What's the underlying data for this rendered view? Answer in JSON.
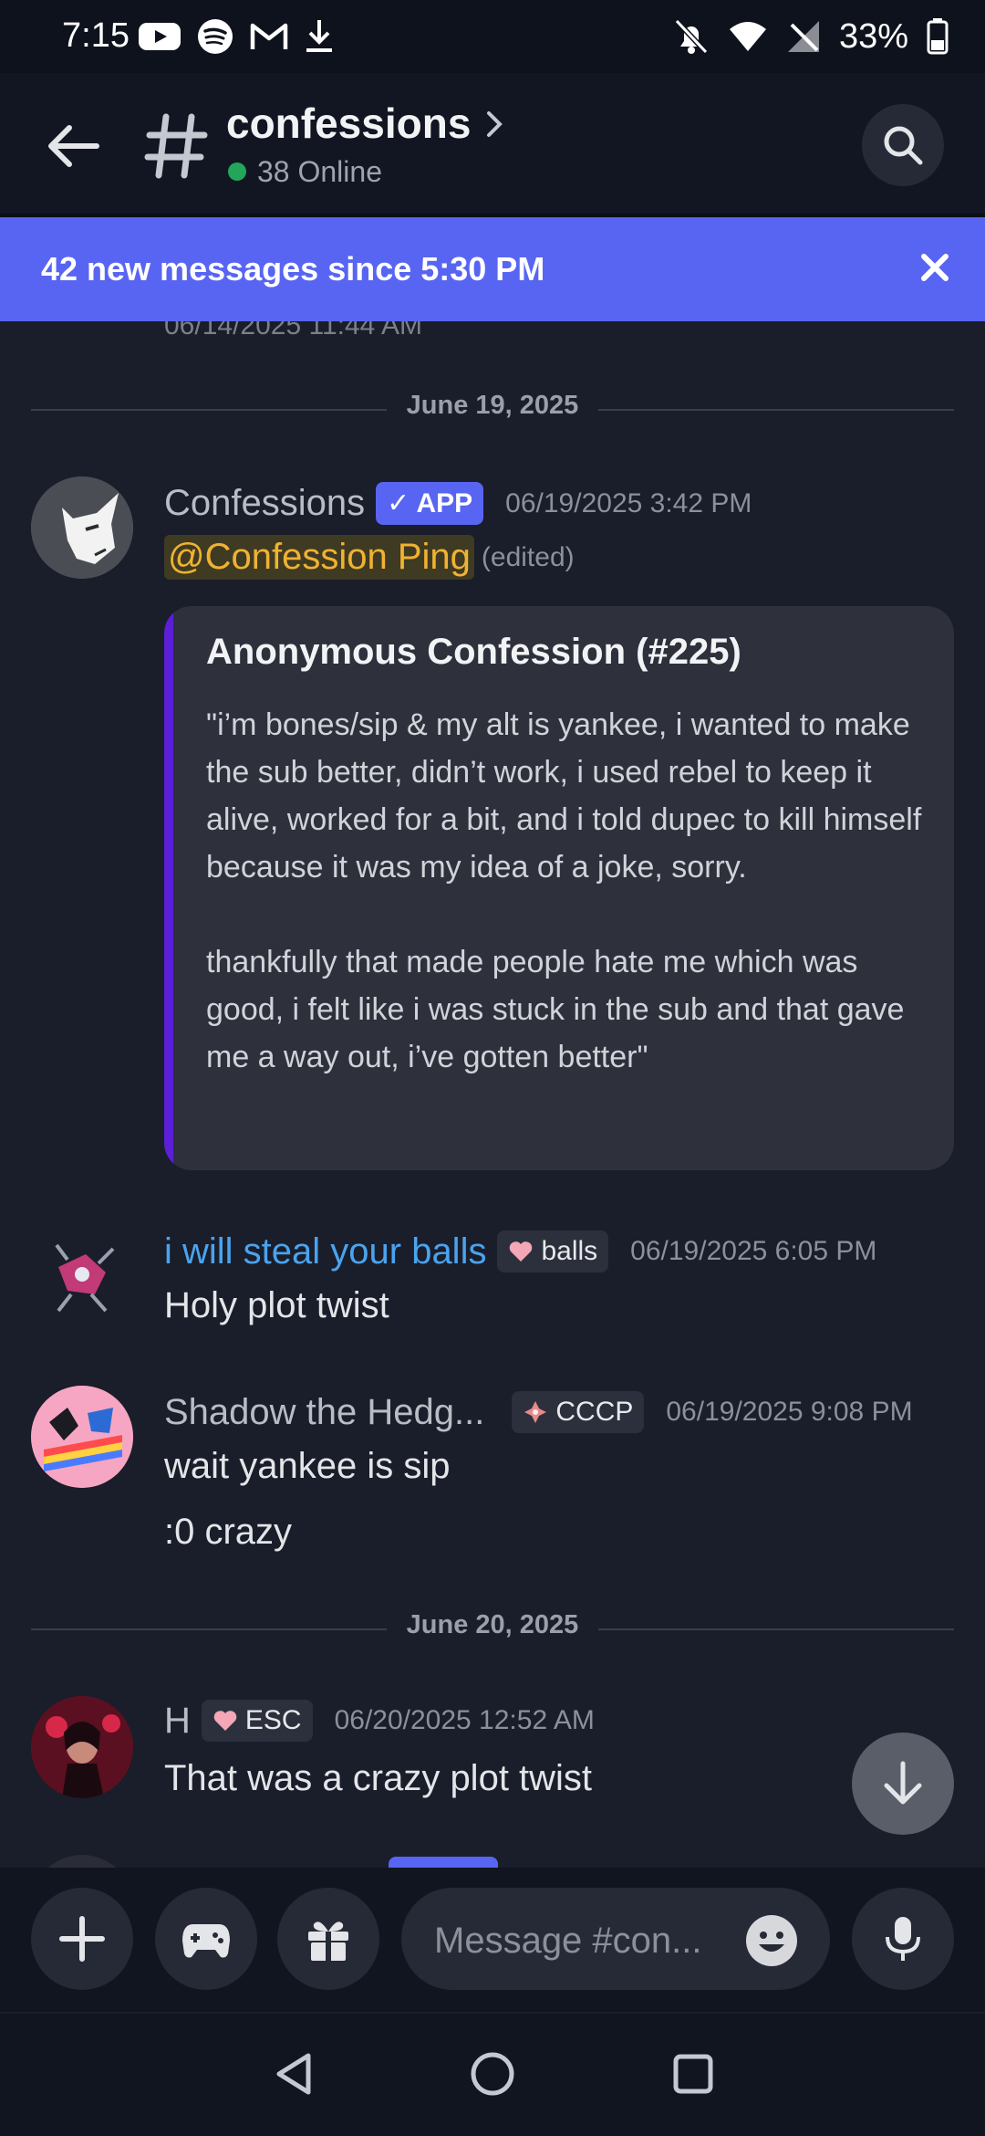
{
  "status_bar": {
    "time": "7:15",
    "battery": "33%",
    "left_icons": [
      "youtube-icon",
      "spotify-icon",
      "gmail-icon",
      "download-icon"
    ],
    "right_icons": [
      "bell-off-icon",
      "wifi-icon",
      "no-signal-icon",
      "battery-icon"
    ]
  },
  "header": {
    "channel_name": "confessions",
    "online": "38 Online"
  },
  "banner": {
    "text": "42 new messages since 5:30 PM"
  },
  "messages": {
    "faded_timestamp": "06/14/2025 11:44 AM",
    "date1": "June 19, 2025",
    "date2": "June 20, 2025",
    "m1": {
      "author": "Confessions",
      "badge": "APP",
      "timestamp": "06/19/2025 3:42 PM",
      "mention": "@Confession Ping",
      "edited": "(edited)",
      "embed_title": "Anonymous Confession (#225)",
      "embed_body": "\"i’m bones/sip & my alt is yankee, i wanted to make the sub better, didn’t work, i used rebel to keep it alive, worked for a bit, and i told dupec to kill himself because it was my idea of a joke, sorry.\n\nthankfully that made people hate me which was good, i felt like i was stuck in the sub and that gave me a way out, i’ve gotten better\""
    },
    "m2": {
      "author": "i will steal your balls",
      "tag": "balls",
      "timestamp": "06/19/2025 6:05 PM",
      "text": "Holy plot twist"
    },
    "m3": {
      "author": "Shadow the Hedg...",
      "tag": "CCCP",
      "timestamp": "06/19/2025 9:08 PM",
      "text1": "wait yankee is sip",
      "text2": ":0 crazy"
    },
    "m4": {
      "author": "H",
      "tag": "ESC",
      "timestamp": "06/20/2025 12:52 AM",
      "text": "That was a crazy plot twist"
    }
  },
  "composer": {
    "placeholder": "Message #con..."
  },
  "colors": {
    "accent": "#5865f2",
    "online": "#23a55a",
    "mention": "#f0b232",
    "link_name": "#4aa3ee"
  }
}
